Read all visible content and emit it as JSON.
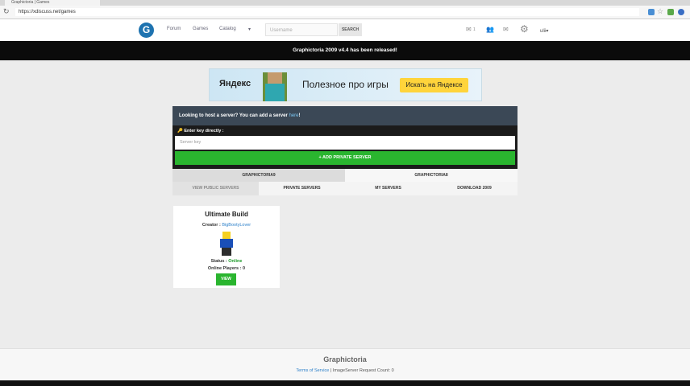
{
  "browser": {
    "tab_title": "Graphictoria | Games",
    "url": "https://xdiscuss.net/games"
  },
  "nav": {
    "logo": "G",
    "links": [
      "Forum",
      "Games",
      "Catalog"
    ],
    "dropdown": "▾",
    "username_placeholder": "Username",
    "search_label": "SEARCH",
    "friends_count": "1",
    "user_name": "ulii",
    "user_caret": "▾"
  },
  "banner": {
    "text": "Graphictoria 2009 v4.4 has been released!"
  },
  "ad": {
    "brand": "Яндекс",
    "text": "Полезное про игры",
    "button": "Искать на Яндексе"
  },
  "server_panel": {
    "host_prompt": "Looking to host a server? You can add a server ",
    "host_link": "here",
    "host_tail": "!",
    "key_label": "Enter key directly :",
    "key_placeholder": "Server key",
    "add_button": "+ ADD PRIVATE SERVER"
  },
  "tabs": {
    "versions": [
      "GRAPHICTORIA9",
      "GRAPHICTORIA8"
    ],
    "sections": [
      "VIEW PUBLIC SERVERS",
      "PRIVATE SERVERS",
      "MY SERVERS",
      "DOWNLOAD 2009"
    ]
  },
  "server_card": {
    "title": "Ultimate Build",
    "creator_label": "Creator : ",
    "creator_name": "BigBootyLover",
    "status_label": "Status : ",
    "status_value": "Online",
    "players_label": "Online Players : ",
    "players_value": "0",
    "view_button": "VIEW"
  },
  "footer": {
    "title": "Graphictoria",
    "terms": "Terms of Service",
    "separator": " | ",
    "request_count": "ImageServer Request Count: 0"
  },
  "colors": {
    "accent_green": "#2ab52f",
    "banner_bg": "#0b0b0b",
    "panel_dark": "#3b4856",
    "logo_blue": "#1e73b0"
  }
}
